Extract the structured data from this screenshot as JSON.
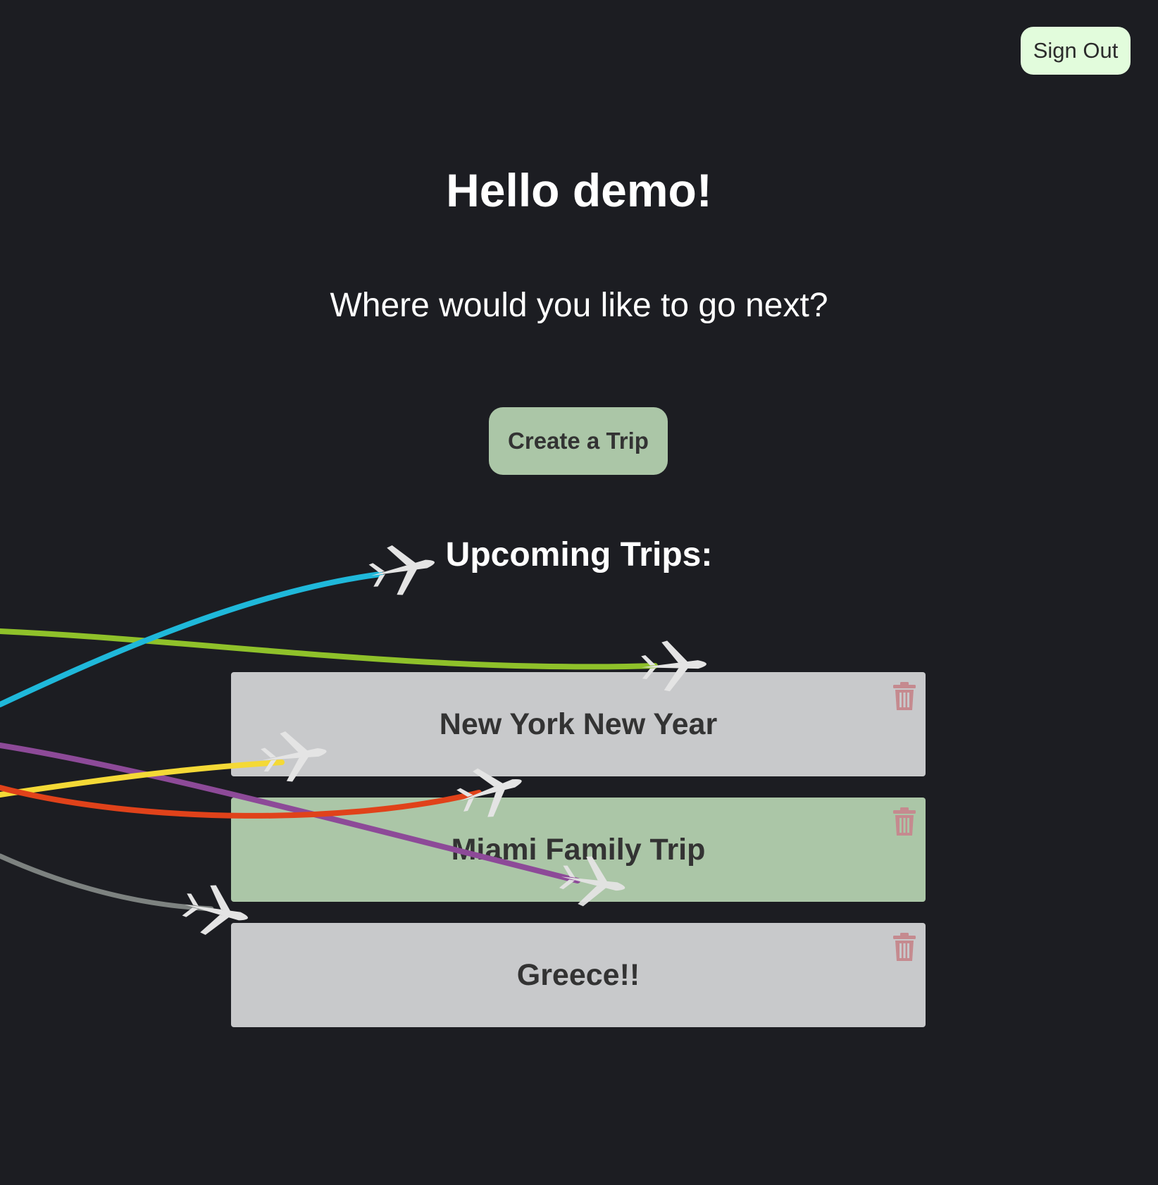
{
  "header": {
    "signout_label": "Sign Out"
  },
  "main": {
    "greeting": "Hello demo!",
    "subtitle": "Where would you like to go next?",
    "create_label": "Create a Trip",
    "upcoming_heading": "Upcoming Trips:"
  },
  "trips": [
    {
      "name": "New York New Year",
      "selected": false
    },
    {
      "name": "Miami Family Trip",
      "selected": true
    },
    {
      "name": "Greece!!",
      "selected": false
    }
  ],
  "icons": {
    "delete": "trash-icon",
    "flight": "airplane-icon"
  },
  "colors": {
    "background": "#1c1d22",
    "signout_bg": "#e2fcdc",
    "accent_green": "#abc6a7",
    "card_gray": "#c8c9cb",
    "trash": "#c58a8f",
    "flight_paths": [
      "#1fb8da",
      "#8fc12a",
      "#8d4a98",
      "#f4d936",
      "#e0421a",
      "#7d8280",
      "#d7d7d7"
    ]
  }
}
